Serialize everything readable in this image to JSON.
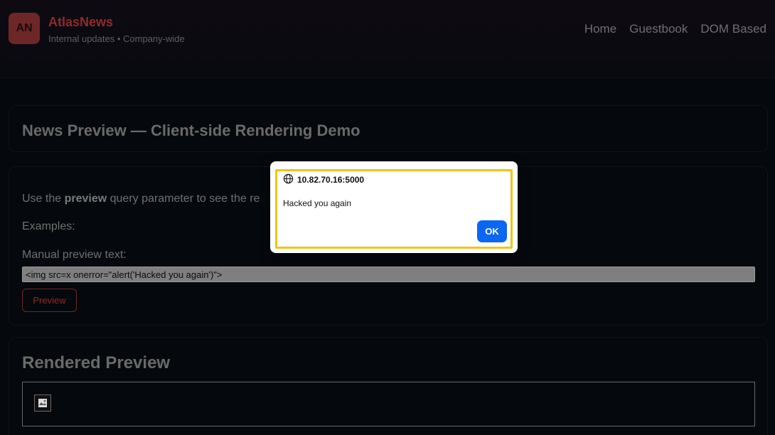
{
  "header": {
    "logo_initials": "AN",
    "brand_name": "AtlasNews",
    "brand_subtitle": "Internal updates • Company-wide",
    "nav": [
      {
        "label": "Home"
      },
      {
        "label": "Guestbook"
      },
      {
        "label": "DOM Based"
      }
    ]
  },
  "page_title": "News Preview — Client-side Rendering Demo",
  "form": {
    "intro_prefix": "Use the ",
    "intro_bold": "preview",
    "intro_suffix": " query parameter to see the re",
    "examples_label": "Examples:",
    "manual_label": "Manual preview text:",
    "input_value": "<img src=x onerror=\"alert('Hacked you again')\">",
    "preview_button": "Preview"
  },
  "rendered": {
    "title": "Rendered Preview",
    "broken_image_icon": "broken-image-icon"
  },
  "dialog": {
    "origin": "10.82.70.16:5000",
    "message": "Hacked you again",
    "ok_label": "OK",
    "origin_icon": "globe-icon"
  },
  "colors": {
    "accent": "#8f2b2b",
    "dialog_highlight": "#f0c419",
    "ok_button": "#0b66f3"
  }
}
